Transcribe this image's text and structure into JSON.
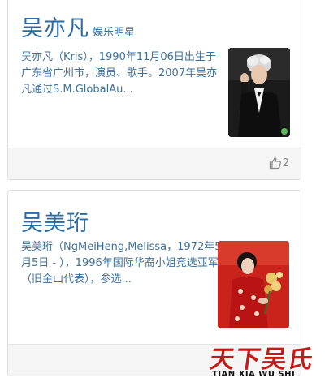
{
  "cards": [
    {
      "name": "吴亦凡",
      "category": "娱乐明星",
      "description": "吴亦凡（Kris），1990年11月06日出生于广东省广州市，演员、歌手。2007年吴亦凡通过S.M.GlobalAu...",
      "thumbnail_icon": "portrait-photo",
      "likes": "2"
    },
    {
      "name": "吴美珩",
      "description": "吴美珩（NgMeiHeng,Melissa，1972年5月5日 - ），1996年国际华裔小姐竞选亚军（旧金山代表），参选...",
      "thumbnail_icon": "portrait-photo"
    }
  ],
  "watermark": {
    "chinese": "天下吴氏",
    "latin": "TIAN XIA WU SHI"
  },
  "colors": {
    "title": "#2a6aa5",
    "description": "#3d6f99",
    "footer_bg": "#f5f5f5",
    "status_dot": "#5cb85c",
    "watermark_red": "#c51b16"
  }
}
